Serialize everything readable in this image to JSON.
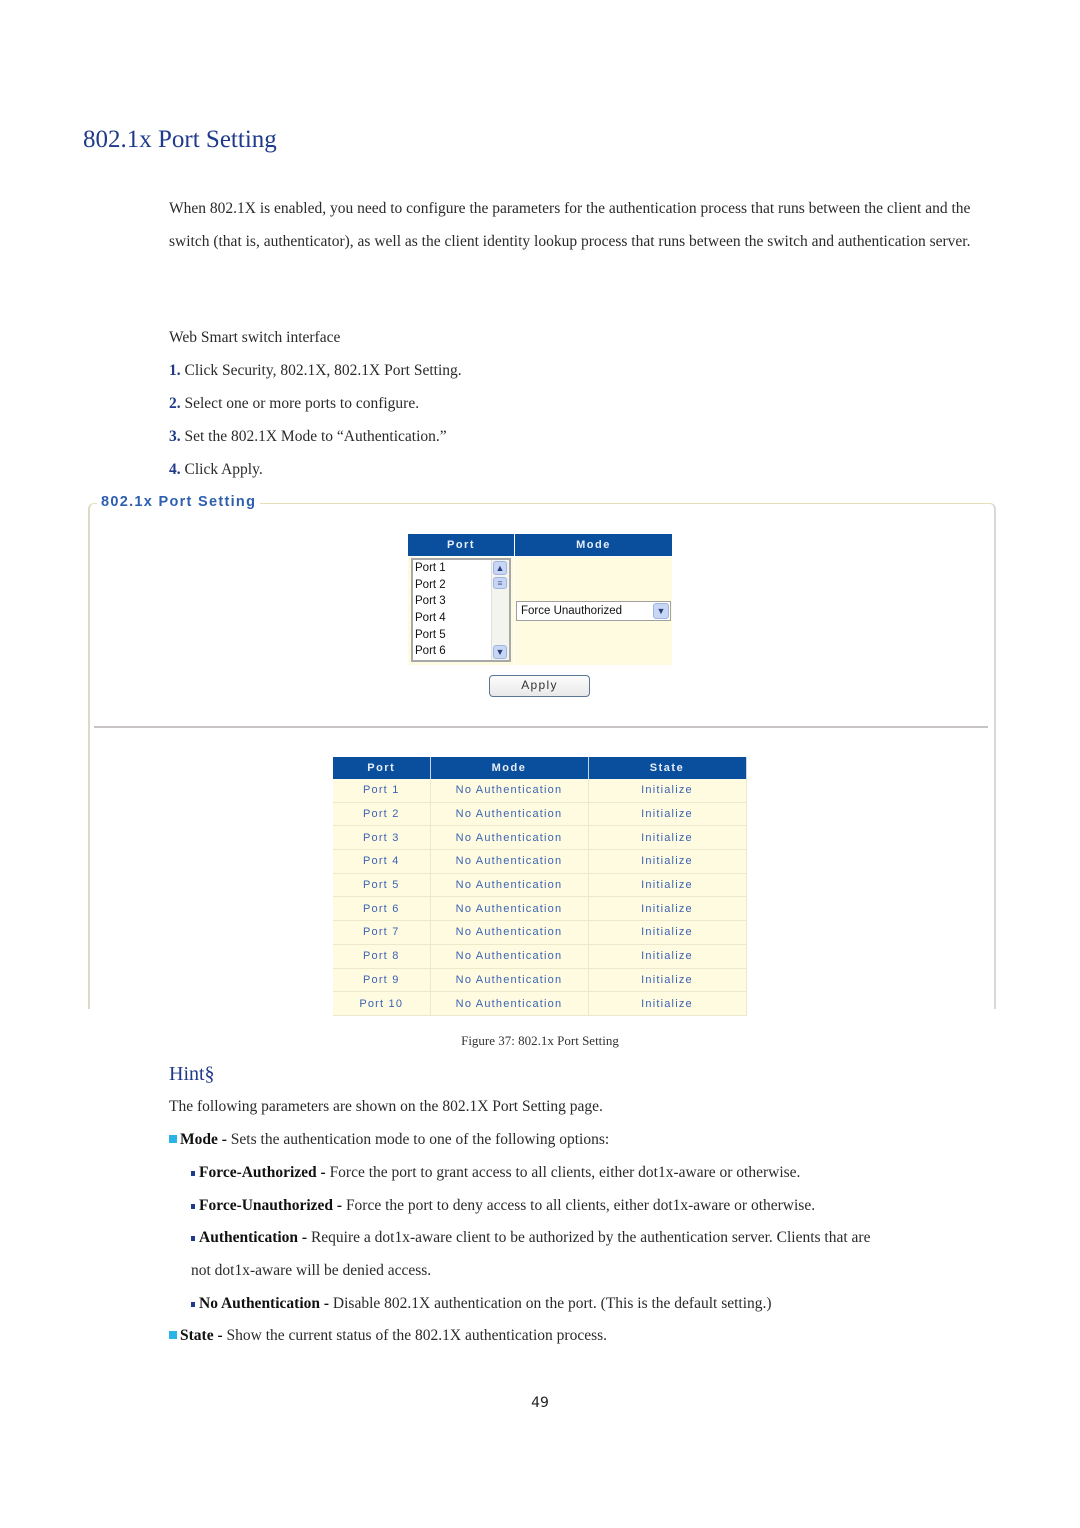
{
  "heading": "802.1x Port Setting",
  "intro": "When 802.1X is enabled, you need to configure the parameters for the authentication process that runs between the client and the switch (that is, authenticator), as well as the client identity lookup process that runs between the switch and authentication server.",
  "interface_label": "Web Smart switch interface",
  "steps": [
    {
      "num": "1.",
      "text": "Click Security, 802.1X, 802.1X Port Setting."
    },
    {
      "num": "2.",
      "text": "Select one or more ports to configure."
    },
    {
      "num": "3.",
      "text": "Set the 802.1X Mode to “Authentication.”"
    },
    {
      "num": "4.",
      "text": "Click Apply."
    }
  ],
  "screenshot": {
    "panel_title": "802.1x Port Setting",
    "config": {
      "headers": {
        "port": "Port",
        "mode": "Mode"
      },
      "port_list": [
        "Port 1",
        "Port 2",
        "Port 3",
        "Port 4",
        "Port 5",
        "Port 6"
      ],
      "mode_selected": "Force Unauthorized",
      "apply_label": "Apply"
    },
    "status_table": {
      "headers": [
        "Port",
        "Mode",
        "State"
      ],
      "rows": [
        [
          "Port 1",
          "No Authentication",
          "Initialize"
        ],
        [
          "Port 2",
          "No Authentication",
          "Initialize"
        ],
        [
          "Port 3",
          "No Authentication",
          "Initialize"
        ],
        [
          "Port 4",
          "No Authentication",
          "Initialize"
        ],
        [
          "Port 5",
          "No Authentication",
          "Initialize"
        ],
        [
          "Port 6",
          "No Authentication",
          "Initialize"
        ],
        [
          "Port 7",
          "No Authentication",
          "Initialize"
        ],
        [
          "Port 8",
          "No Authentication",
          "Initialize"
        ],
        [
          "Port 9",
          "No Authentication",
          "Initialize"
        ],
        [
          "Port 10",
          "No Authentication",
          "Initialize"
        ]
      ]
    }
  },
  "caption": "Figure 37: 802.1x Port Setting",
  "hint": {
    "title": "Hint§",
    "lead": "The following parameters are shown on the 802.1X Port Setting page.",
    "mode": {
      "term": "Mode - ",
      "desc": "Sets the authentication mode to one of the following options:"
    },
    "options": [
      {
        "term": "Force-Authorized - ",
        "desc": "Force the port to grant access to all clients, either dot1x-aware or otherwise."
      },
      {
        "term": "Force-Unauthorized - ",
        "desc": "Force the port to deny access to all clients, either dot1x-aware or otherwise."
      },
      {
        "term": "Authentication - ",
        "desc": "Require a dot1x-aware client to be authorized by the authentication server. Clients that are",
        "cont": "not dot1x-aware will be denied access."
      },
      {
        "term": "No Authentication - ",
        "desc": "Disable 802.1X authentication on the port. (This is the default setting.)"
      }
    ],
    "state": {
      "term": "State - ",
      "desc": "Show the current status of the 802.1X authentication process."
    }
  },
  "page_number": "49"
}
